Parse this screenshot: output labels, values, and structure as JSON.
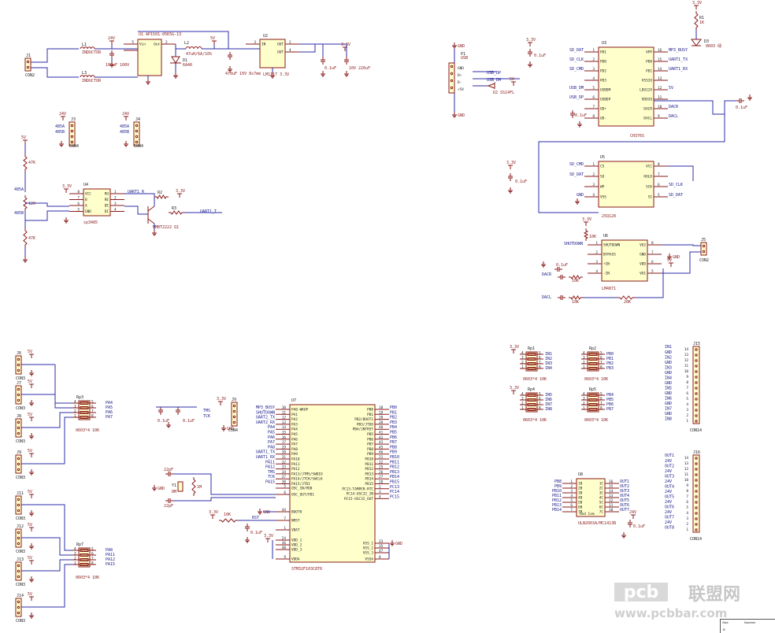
{
  "page": {
    "title": ""
  },
  "colors": {
    "component": "#8a1a1a",
    "wire": "#2c2ca8",
    "body_fill": "#ffffcc",
    "net_label": "#1a1a8a"
  },
  "power": {
    "labels": {
      "v24": "24V",
      "v5": "5V",
      "v33": "3.3V",
      "gnd": "GND"
    },
    "u1": {
      "ref": "U1",
      "part": "AP1501-05K5G-13",
      "vin": "Vin",
      "out": "Out"
    },
    "u2": {
      "ref": "U2",
      "part": "LM1117 3.3V",
      "in": "IN",
      "out": "OUT"
    },
    "d1": {
      "ref": "D1",
      "part": "6A40"
    },
    "l1": {
      "ref": "L1",
      "part": "INDUCTOR"
    },
    "l2": {
      "ref": "L2",
      "part": "47uH/6A/10%"
    },
    "l3": {
      "ref": "L3",
      "part": "INDUCTOR"
    },
    "c_in": "100uF 100V",
    "c_out": "470uF 10V 8x7mm",
    "c_33a": "0.1uF",
    "c_33b": "10V 220uF",
    "j1": {
      "ref": "J1",
      "name": "CON2"
    }
  },
  "rs485": {
    "u4": {
      "ref": "U4",
      "part": "sp3485",
      "pins": [
        "VCC",
        "B",
        "A",
        "GND",
        "RO",
        "RE",
        "DE",
        "DI"
      ]
    },
    "q1": {
      "ref": "Q1",
      "part": "MMBT2222 Q1"
    },
    "nets": {
      "uart1_r": "UART1_R",
      "uart1_t": "UART1_T",
      "a": "485A",
      "b": "485B"
    },
    "r_bias": "47K",
    "r_term": "120",
    "j3": {
      "ref": "J3",
      "name": "CON4"
    },
    "j4": {
      "ref": "J4",
      "name": "CON4"
    }
  },
  "usb": {
    "p1": {
      "ref": "P1",
      "name": "USB"
    },
    "pins": [
      "GND",
      "D+",
      "D-",
      "+5V"
    ],
    "d2": {
      "ref": "D2",
      "part": "SS14FL"
    },
    "nets": [
      "USB_DP",
      "USB_DM"
    ]
  },
  "u3": {
    "ref": "U3",
    "part": "CH376S",
    "left_pins": [
      [
        "SD_DAT",
        "1",
        "PD1"
      ],
      [
        "SD_CLK",
        "2",
        "PD0"
      ],
      [
        "SD_CMD",
        "3",
        "PD2"
      ],
      [
        "",
        "4",
        "PD3"
      ],
      [
        "USB_DM",
        "5",
        "USBDM"
      ],
      [
        "USB_DP",
        "6",
        "USBDP"
      ],
      [
        "",
        "7",
        "UD+"
      ],
      [
        "",
        "8",
        "UD-"
      ]
    ],
    "right_pins": [
      [
        "VPP",
        "16",
        "MP3_BUSY"
      ],
      [
        "PD0",
        "15",
        "UART1_TX"
      ],
      [
        "PD1",
        "14",
        "UART1_RX"
      ],
      [
        "VSSIO",
        "13",
        ""
      ],
      [
        "LDO12V",
        "12",
        "5V"
      ],
      [
        "VDDIO",
        "11",
        ""
      ],
      [
        "DACR",
        "10",
        "DACR"
      ],
      [
        "DACL",
        "9",
        "DACL"
      ]
    ]
  },
  "u5": {
    "ref": "U5",
    "part": "25Q128",
    "left": [
      [
        "SD_CMD",
        "1",
        "CS"
      ],
      [
        "SD_DAT",
        "2",
        "SO"
      ],
      [
        "",
        "3",
        "WP"
      ],
      [
        "GND",
        "4",
        "VSS"
      ]
    ],
    "right": [
      [
        "VCC",
        "8",
        ""
      ],
      [
        "HOLD",
        "7",
        ""
      ],
      [
        "SCK",
        "6",
        "SD_CLK"
      ],
      [
        "SI",
        "5",
        "SD_DAT"
      ]
    ]
  },
  "u6": {
    "ref": "U6",
    "part": "LM4871",
    "left": [
      [
        "SHUTDOWN",
        "1"
      ],
      [
        "BYPASS",
        "2"
      ],
      [
        "+IN",
        "3"
      ],
      [
        "-IN",
        "4"
      ]
    ],
    "right": [
      [
        "VO2",
        "8"
      ],
      [
        "GND",
        "7"
      ],
      [
        "VDD",
        "6"
      ],
      [
        "VO1",
        "5"
      ]
    ],
    "nets": {
      "shutdown": "SHUTDOWN",
      "dacr": "DACR",
      "dacl": "DACL"
    },
    "r": [
      "10K",
      "10K",
      "20K"
    ],
    "c": [
      "0.1uF",
      "0.1uF"
    ],
    "j5": {
      "ref": "J5",
      "name": "CON2"
    }
  },
  "u7": {
    "ref": "U7",
    "part": "STM32F103C8T6",
    "left": [
      [
        "MP3_BUSY",
        "10",
        "PA0-WKUP"
      ],
      [
        "SHUTDOWN",
        "11",
        "PA1"
      ],
      [
        "UART2_TX",
        "12",
        "PA2"
      ],
      [
        "UART2_RX",
        "13",
        "PA3"
      ],
      [
        "PA4",
        "14",
        "PA4"
      ],
      [
        "PA5",
        "15",
        "PA5"
      ],
      [
        "PA6",
        "16",
        "PA6"
      ],
      [
        "PA7",
        "17",
        "PA7"
      ],
      [
        "PA8",
        "29",
        "PA8"
      ],
      [
        "UART1_TX",
        "30",
        "PA9"
      ],
      [
        "UART1_RX",
        "31",
        "PA10"
      ],
      [
        "PA11",
        "32",
        "PA11"
      ],
      [
        "PA12",
        "33",
        "PA12"
      ],
      [
        "TMS",
        "34",
        "PA13/JTMS/SWDIO"
      ],
      [
        "TCK",
        "37",
        "PA14/JTCK/SWCLK"
      ],
      [
        "PA15",
        "38",
        "PA15/JTDI"
      ]
    ],
    "right": [
      [
        "PB0",
        "18",
        "PB0"
      ],
      [
        "PB1",
        "19",
        "PB1"
      ],
      [
        "PB2",
        "20",
        "PB2/BOOT1"
      ],
      [
        "PB3",
        "39",
        "PB3/JTDO"
      ],
      [
        "PB4",
        "40",
        "PB4/JNTRST"
      ],
      [
        "PB5",
        "41",
        "PB5"
      ],
      [
        "PB6",
        "42",
        "PB6"
      ],
      [
        "PB7",
        "43",
        "PB7"
      ],
      [
        "PB8",
        "45",
        "PB8"
      ],
      [
        "PB9",
        "46",
        "PB9"
      ],
      [
        "PB10",
        "21",
        "PB10"
      ],
      [
        "PB11",
        "22",
        "PB11"
      ],
      [
        "PB12",
        "25",
        "PB12"
      ],
      [
        "PB13",
        "26",
        "PB13"
      ],
      [
        "PB14",
        "27",
        "PB14"
      ],
      [
        "PB15",
        "28",
        "PB15"
      ],
      [
        "PC13",
        "2",
        "PC13-TAMPER-RTC"
      ],
      [
        "PC14",
        "3",
        "PC14-OSC32_IN"
      ],
      [
        "PC15",
        "4",
        "PC15-OSC32_OUT"
      ]
    ],
    "misc_left": [
      [
        "5",
        "OSC_IN/PD0"
      ],
      [
        "6",
        "OSC_OUT/PD1"
      ],
      [
        "44",
        "BOOT0"
      ],
      [
        "7",
        "NRST"
      ],
      [
        "1",
        "VBAT"
      ],
      [
        "24",
        "VDD_1"
      ],
      [
        "36",
        "VDD_2"
      ],
      [
        "48",
        "VDD_3"
      ],
      [
        "9",
        "VDDA"
      ]
    ],
    "misc_right": [
      [
        "23",
        "VSS_1"
      ],
      [
        "35",
        "VSS_2"
      ],
      [
        "47",
        "VSS_3"
      ],
      [
        "8",
        "VSSA"
      ]
    ]
  },
  "crystal": {
    "y1": "Y1",
    "freq": "8M",
    "r": "1M",
    "c": [
      "22pF",
      "22pF"
    ],
    "c_dec": [
      "0.1uF",
      "0.1uF"
    ]
  },
  "reset": {
    "r": "10K",
    "c": "0.1uF",
    "net": "RST"
  },
  "swd": {
    "ref": "J9",
    "name": "CON4",
    "nets": [
      "3.3V",
      "TMS",
      "TCK",
      "GND"
    ]
  },
  "left_connectors": [
    {
      "ref": "J6",
      "name": "CON3",
      "net": "PA4"
    },
    {
      "ref": "J7",
      "name": "CON3",
      "net": "PA5"
    },
    {
      "ref": "J8",
      "name": "CON3",
      "net": "PA6"
    },
    {
      "ref": "J9",
      "name": "CON3",
      "net": "PA7"
    },
    {
      "ref": "J11",
      "name": "CON3",
      "net": "PA8"
    },
    {
      "ref": "J12",
      "name": "CON3",
      "net": "PA11"
    },
    {
      "ref": "J13",
      "name": "CON3",
      "net": "PA12"
    },
    {
      "ref": "J14",
      "name": "CON3",
      "net": "PA15"
    }
  ],
  "rp_left": [
    {
      "ref": "Rp3",
      "part": "0603*4 10K",
      "nets": [
        "PA4",
        "PA5",
        "PA6",
        "PA7"
      ]
    },
    {
      "ref": "Rp7",
      "part": "0603*4 10K",
      "nets": [
        "PA8",
        "PA11",
        "PA12",
        "PA15"
      ]
    }
  ],
  "rp_right": [
    {
      "ref": "Rp1",
      "part": "0603*4 10K",
      "nets": [
        "IN1",
        "IN2",
        "IN3",
        "IN4"
      ]
    },
    {
      "ref": "Rp2",
      "part": "0603*4 10K",
      "nets": [
        "PB0",
        "PB1",
        "PB2",
        "PB3"
      ]
    },
    {
      "ref": "Rp4",
      "part": "0603*4 10K",
      "nets": [
        "IN5",
        "IN6",
        "IN7",
        "IN8"
      ]
    },
    {
      "ref": "Rp5",
      "part": "0603*4 10K",
      "nets": [
        "PB4",
        "PB5",
        "PB6",
        "PB7"
      ]
    }
  ],
  "u8": {
    "ref": "U8",
    "part": "ULN2003A/MC1413B",
    "left": [
      [
        "PB8",
        "1",
        "1B"
      ],
      [
        "PB9",
        "2",
        "2B"
      ],
      [
        "PB10",
        "3",
        "3B"
      ],
      [
        "PB11",
        "4",
        "4B"
      ],
      [
        "PB12",
        "5",
        "5B"
      ],
      [
        "PB13",
        "6",
        "6B"
      ],
      [
        "PB14",
        "7",
        "7B"
      ]
    ],
    "right": [
      [
        "1C",
        "16",
        "OUT1"
      ],
      [
        "2C",
        "15",
        "OUT2"
      ],
      [
        "3C",
        "14",
        "OUT3"
      ],
      [
        "4C",
        "13",
        "OUT4"
      ],
      [
        "5C",
        "12",
        "OUT5"
      ],
      [
        "6C",
        "11",
        "OUT6"
      ],
      [
        "7C",
        "10",
        "OUT7"
      ]
    ],
    "bottom": "Gnd Com",
    "c": "0.1uF"
  },
  "j_in": {
    "ref": "J15",
    "name": "CON14",
    "top_net": "IN1",
    "labels": [
      "GND",
      "IN2",
      "GND",
      "IN3",
      "GND",
      "IN4",
      "GND",
      "IN5",
      "GND",
      "IN6",
      "GND",
      "IN7",
      "GND",
      "IN8"
    ]
  },
  "j_out": {
    "ref": "J16",
    "name": "CON14",
    "top_net": "OUT1",
    "labels": [
      "24V",
      "OUT2",
      "24V",
      "OUT3",
      "24V",
      "OUT4",
      "24V",
      "OUT5",
      "24V",
      "OUT6",
      "24V",
      "OUT7",
      "24V",
      "OUT8"
    ]
  },
  "led": {
    "ref": "D3",
    "part": "0603 绿",
    "r": "R1",
    "rv": "1K"
  },
  "watermark": {
    "logo": "pcb",
    "cn": "联盟网",
    "url": "www.pcbbar.com"
  },
  "title_block": {
    "size_label": "Size",
    "size": "B",
    "number_label": "Number"
  }
}
